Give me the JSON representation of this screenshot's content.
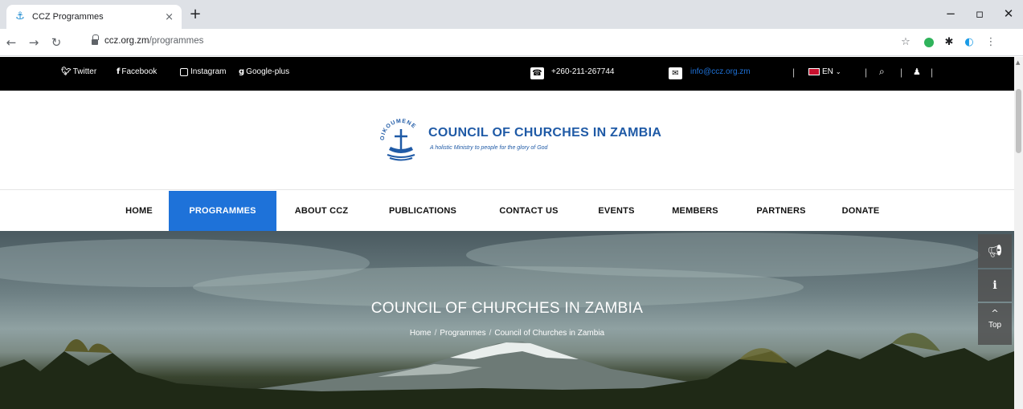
{
  "browser": {
    "tab_title": "CCZ Programmes",
    "tab_close": "×",
    "new_tab": "+",
    "url_host": "ccz.org.zm",
    "url_path": "/programmes",
    "window_controls": {
      "minimize": "−",
      "maximize": "▫",
      "close": "✕"
    }
  },
  "topbar": {
    "social": [
      {
        "icon": "twitter-icon",
        "label": "Twitter"
      },
      {
        "icon": "facebook-icon",
        "label": "Facebook"
      },
      {
        "icon": "instagram-icon",
        "label": "Instagram"
      },
      {
        "icon": "google-plus-icon",
        "label": "Google-plus"
      }
    ],
    "phone": "+260-211-267744",
    "email": "info@ccz.org.zm",
    "language": "EN"
  },
  "logo": {
    "title": "COUNCIL OF CHURCHES IN ZAMBIA",
    "tagline": "A holistic Ministry to people for the glory of God",
    "emblem_text": "OIKOUMENE"
  },
  "nav": {
    "items": [
      "HOME",
      "PROGRAMMES",
      "ABOUT CCZ",
      "PUBLICATIONS",
      "CONTACT US",
      "EVENTS",
      "MEMBERS",
      "PARTNERS",
      "DONATE"
    ],
    "active": "PROGRAMMES"
  },
  "hero": {
    "title": "COUNCIL OF CHURCHES IN ZAMBIA",
    "breadcrumb": [
      "Home",
      "Programmes",
      "Council of Churches in Zambia"
    ]
  },
  "side_buttons": {
    "top_label": "Top"
  },
  "colors": {
    "accent": "#1e72d9",
    "brand": "#1f5aa6",
    "topbar": "#000000"
  }
}
